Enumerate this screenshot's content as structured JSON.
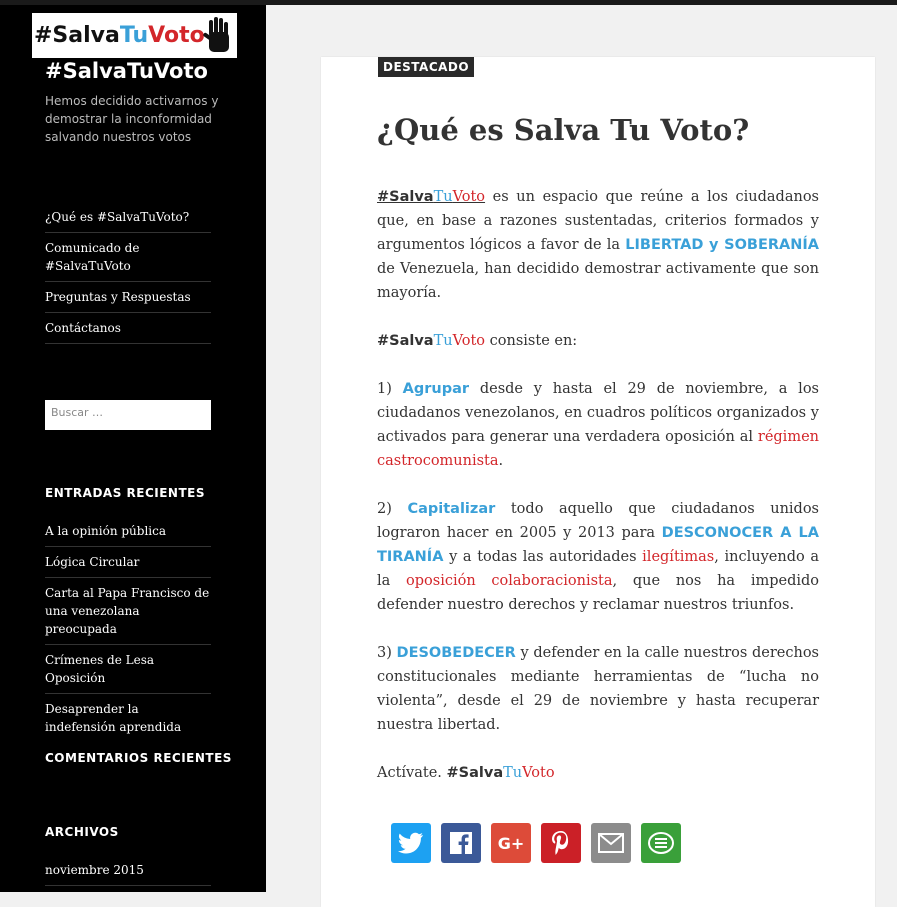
{
  "sidebar": {
    "logo": {
      "part1": "#Salva",
      "part2": "Tu",
      "part3": "Voto"
    },
    "site_title": "#SalvaTuVoto",
    "site_description": "Hemos decidido activarnos y demostrar la inconformidad salvando nuestros votos",
    "nav": [
      "¿Qué es #SalvaTuVoto?",
      "Comunicado de #SalvaTuVoto",
      "Preguntas y Respuestas",
      "Contáctanos"
    ],
    "search_placeholder": "Buscar …",
    "recent_posts_title": "ENTRADAS RECIENTES",
    "recent_posts": [
      "A la opinión pública",
      "Lógica Circular",
      "Carta al Papa Francisco de una venezolana preocupada",
      "Crímenes de Lesa Oposición",
      "Desaprender la indefensión aprendida"
    ],
    "recent_comments_title": "COMENTARIOS RECIENTES",
    "archives_title": "ARCHIVOS",
    "archives": [
      "noviembre 2015"
    ]
  },
  "post": {
    "badge": "DESTACADO",
    "title": "¿Qué es Salva Tu Voto?",
    "brand": {
      "a": "#Salva",
      "b": "Tu",
      "c": "Voto"
    },
    "p1": {
      "t1": " es un espacio que reúne a los ciudadanos que, en base a razones sustentadas, criterios formados y argumentos lógicos a favor de la ",
      "hl": "LIBERTAD y SOBERANÍA",
      "t2": " de Venezuela, han decidido demostrar activamente que son mayoría."
    },
    "p2": {
      "t1": " consiste en:"
    },
    "p3": {
      "num": "1) ",
      "hl": "Agrupar",
      "t1": " desde y hasta el 29 de noviembre, a los ciudadanos venezolanos, en cuadros políticos organizados y activados para generar una verdadera oposición al ",
      "red": "régimen castrocomunista",
      "t2": "."
    },
    "p4": {
      "num": "2) ",
      "hl": "Capitalizar",
      "t1": " todo aquello que ciudadanos unidos lograron hacer en 2005 y 2013 para ",
      "hl2": "DESCONOCER A LA TIRANÍA",
      "t2": " y a todas las autoridades ",
      "red1": "ilegítimas",
      "t3": ", incluyendo a la ",
      "red2": "oposición colaboracionista",
      "t4": ", que nos ha impedido defender nuestro derechos y reclamar nuestros triunfos."
    },
    "p5": {
      "num": "3) ",
      "hl": "DESOBEDECER",
      "t1": " y defender en la calle nuestros derechos constitucionales mediante herramientas de “lucha no violenta”, desde el 29 de noviembre y hasta recuperar nuestra libertad."
    },
    "p6": {
      "t1": "Actívate. "
    }
  },
  "share_buttons": [
    {
      "name": "twitter-share-button",
      "icon": "twitter-icon",
      "glyph": "",
      "color": "#1da1f2"
    },
    {
      "name": "facebook-share-button",
      "icon": "facebook-icon",
      "glyph": "",
      "color": "#3b5998"
    },
    {
      "name": "googleplus-share-button",
      "icon": "google-plus-icon",
      "glyph": "G+",
      "color": "#dd4b39"
    },
    {
      "name": "pinterest-share-button",
      "icon": "pinterest-icon",
      "glyph": "",
      "color": "#cb2027"
    },
    {
      "name": "email-share-button",
      "icon": "email-icon",
      "glyph": "",
      "color": "#8c8c8c"
    },
    {
      "name": "more-share-button",
      "icon": "share-icon",
      "glyph": "",
      "color": "#3aa03a"
    }
  ]
}
